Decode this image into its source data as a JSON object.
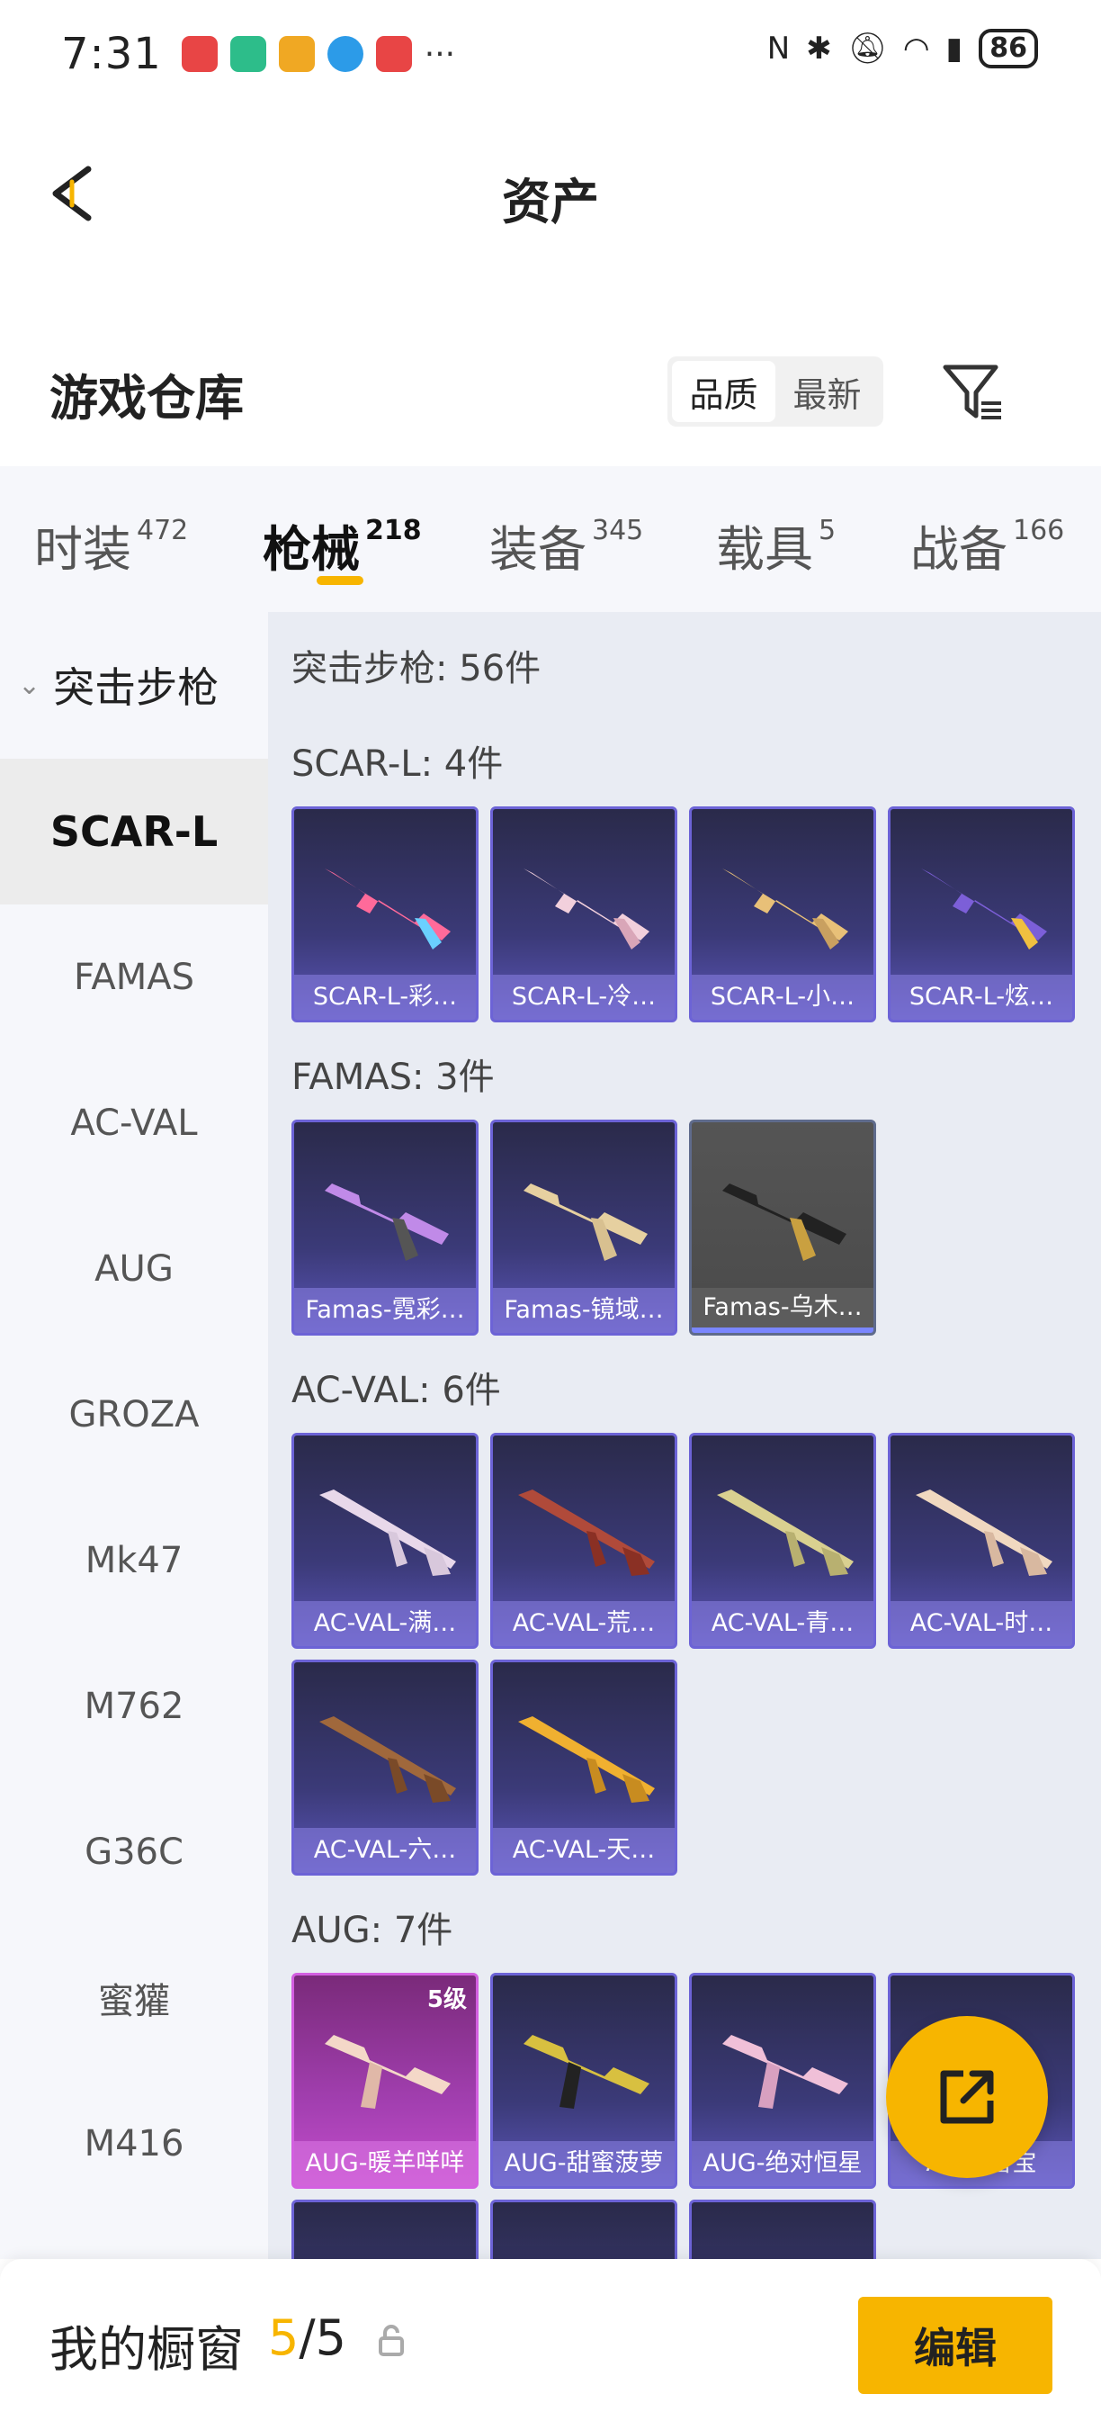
{
  "status": {
    "time": "7:31",
    "more": "···",
    "battery": "86",
    "app_colors": [
      "#e84545",
      "#2dbd8a",
      "#f0a823",
      "#2c9be8",
      "#e84545"
    ]
  },
  "nav": {
    "title": "资产"
  },
  "warehouse": {
    "title": "游戏仓库",
    "sort_options": [
      "品质",
      "最新"
    ],
    "active_sort": "品质"
  },
  "tabs": [
    {
      "label": "时装",
      "count": "472"
    },
    {
      "label": "枪械",
      "count": "218"
    },
    {
      "label": "装备",
      "count": "345"
    },
    {
      "label": "载具",
      "count": "5"
    },
    {
      "label": "战备",
      "count": "166"
    }
  ],
  "sidebar": {
    "group": "突击步枪",
    "items": [
      "SCAR-L",
      "FAMAS",
      "AC-VAL",
      "AUG",
      "GROZA",
      "Mk47",
      "M762",
      "G36C",
      "蜜獾",
      "M416"
    ]
  },
  "content": {
    "total": "突击步枪: 56件",
    "sections": [
      {
        "title": "SCAR-L: 4件",
        "items": [
          "SCAR-L-彩…",
          "SCAR-L-冷…",
          "SCAR-L-小…",
          "SCAR-L-炫…"
        ]
      },
      {
        "title": "FAMAS: 3件",
        "items": [
          "Famas-霓彩…",
          "Famas-镜域…",
          "Famas-乌木…"
        ]
      },
      {
        "title": "AC-VAL: 6件",
        "items": [
          "AC-VAL-满…",
          "AC-VAL-荒…",
          "AC-VAL-青…",
          "AC-VAL-时…",
          "AC-VAL-六…",
          "AC-VAL-天…"
        ]
      },
      {
        "title": "AUG: 7件",
        "items": [
          "AUG-暖羊咩咩",
          "AUG-甜蜜菠萝",
          "AUG-绝对恒星",
          "AUG-雪宝"
        ],
        "level": "5级"
      }
    ]
  },
  "showcase": {
    "title": "我的橱窗",
    "current": "5",
    "separator": "/",
    "total": "5",
    "edit_label": "编辑"
  },
  "colors": {
    "accent": "#f7b500",
    "card_purple": "#3b3a78",
    "card_pink": "#a23fb0"
  }
}
